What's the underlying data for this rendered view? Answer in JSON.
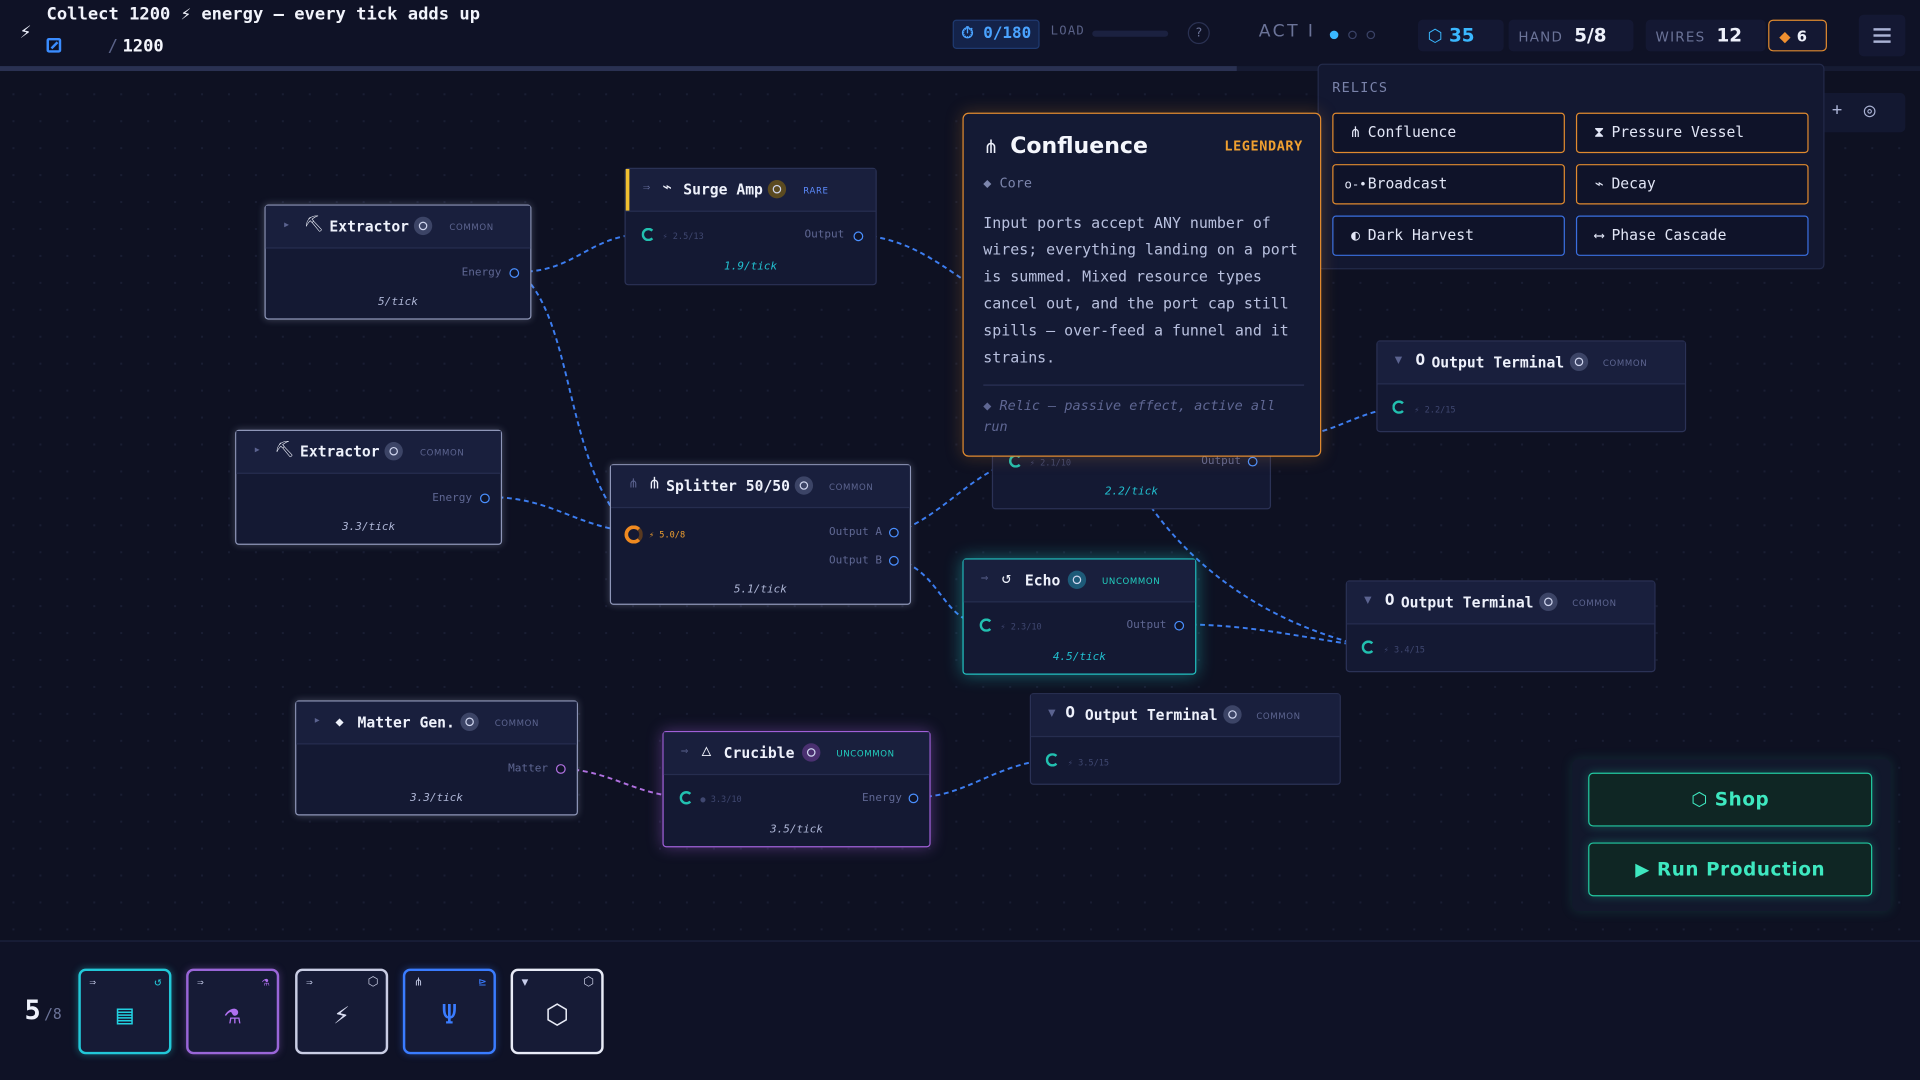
{
  "objective": {
    "text": "Collect 1200 ⚡ energy — every tick adds up",
    "progress_value": "",
    "target": "1200"
  },
  "timer": "⏱ 0/180",
  "load_label": "LOAD",
  "help": "?",
  "act": {
    "label": "ACT I",
    "current": 1,
    "total": 3
  },
  "stats": {
    "coins": {
      "icon": "⬡",
      "value": "35"
    },
    "hand": {
      "label": "HAND",
      "value": "5/8"
    },
    "wires": {
      "label": "WIRES",
      "value": "12"
    },
    "gems": {
      "icon": "◆",
      "value": "6"
    }
  },
  "colors": {
    "accent_blue": "#3a8cff",
    "legendary": "#e08a2f",
    "rare": "#f0c030",
    "uncommon_teal": "#22d0c0",
    "uncommon_purple": "#b070f0",
    "shop_green": "#22c9a0"
  },
  "nodes": [
    {
      "id": "extractor1",
      "title": "Extractor",
      "icon": "⛏",
      "rarity": "COMMON",
      "port_out": "Energy",
      "rate": "5/tick"
    },
    {
      "id": "surge",
      "title": "Surge Amp",
      "icon": "⌁",
      "rarity": "RARE",
      "in_value": "⚡ 2.5/13",
      "port_out": "Output",
      "rate": "1.9/tick"
    },
    {
      "id": "extractor2",
      "title": "Extractor",
      "icon": "⛏",
      "rarity": "COMMON",
      "port_out": "Energy",
      "rate": "3.3/tick"
    },
    {
      "id": "splitter",
      "title": "Splitter 50/50",
      "icon": "⋔",
      "rarity": "COMMON",
      "in_value": "⚡ 5.0/8",
      "port_a": "Output A",
      "port_b": "Output B",
      "rate": "5.1/tick"
    },
    {
      "id": "hidden",
      "in_value": "⚡ 2.1/10",
      "port_out": "Output",
      "rate": "2.2/tick"
    },
    {
      "id": "echo",
      "title": "Echo",
      "icon": "↺",
      "rarity": "UNCOMMON",
      "in_value": "⚡ 2.3/10",
      "port_out": "Output",
      "rate": "4.5/tick"
    },
    {
      "id": "term1",
      "title": "Output Terminal",
      "icon": "O",
      "rarity": "COMMON",
      "in_value": "⚡ 2.2/15"
    },
    {
      "id": "term2",
      "title": "Output Terminal",
      "icon": "O",
      "rarity": "COMMON",
      "in_value": "⚡ 3.4/15"
    },
    {
      "id": "term3",
      "title": "Output Terminal",
      "icon": "O",
      "rarity": "COMMON",
      "in_value": "⚡ 3.5/15"
    },
    {
      "id": "matter",
      "title": "Matter Gen.",
      "icon": "◆",
      "rarity": "COMMON",
      "port_out": "Matter",
      "rate": "3.3/tick"
    },
    {
      "id": "crucible",
      "title": "Crucible",
      "icon": "△",
      "rarity": "UNCOMMON",
      "in_value": "● 3.3/10",
      "port_out": "Energy",
      "rate": "3.5/tick"
    }
  ],
  "tooltip": {
    "icon": "⋔",
    "title": "Confluence",
    "rarity": "LEGENDARY",
    "type": "◆ Core",
    "description": "Input ports accept ANY number of wires; everything landing on a port is summed. Mixed resource types cancel out, and the port cap still spills — over-feed a funnel and it strains.",
    "footer": "◆ Relic — passive effect, active all run"
  },
  "relics": {
    "title": "RELICS",
    "items": [
      {
        "icon": "⋔",
        "label": "Confluence",
        "style": "orange"
      },
      {
        "icon": "⧗",
        "label": "Pressure Vessel",
        "style": "orange"
      },
      {
        "icon": "o-•",
        "label": "Broadcast",
        "style": "orange"
      },
      {
        "icon": "⌁",
        "label": "Decay",
        "style": "orange"
      },
      {
        "icon": "◐",
        "label": "Dark Harvest",
        "style": "blue"
      },
      {
        "icon": "⟷",
        "label": "Phase Cascade",
        "style": "blue"
      }
    ]
  },
  "side_controls": {
    "zoom_in": "+",
    "center": "◎"
  },
  "buttons": {
    "shop": "⬡ Shop",
    "run": "▶ Run Production"
  },
  "hand_panel": {
    "count": "5",
    "max": "/8"
  },
  "cards": [
    {
      "input": "⇒",
      "badge": "↺",
      "icon": "▤",
      "color": "#22d0e0"
    },
    {
      "input": "⇒",
      "badge": "⚗",
      "icon": "⚗",
      "color": "#b070f0"
    },
    {
      "input": "⇒",
      "badge": "⬡",
      "icon": "⚡",
      "color": "#d8dcf0"
    },
    {
      "input": "⋔",
      "badge": "⊵",
      "icon": "Ψ",
      "color": "#3a7cff"
    },
    {
      "input": "▼",
      "badge": "⬡",
      "icon": "⬡",
      "color": "#e8ebf6"
    }
  ]
}
